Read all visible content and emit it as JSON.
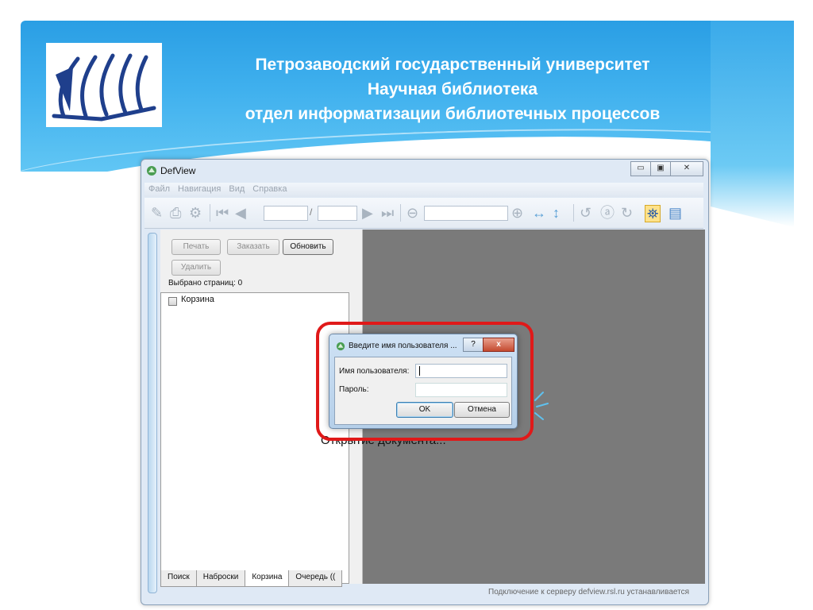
{
  "slide": {
    "title_line1": "Петрозаводский государственный университет",
    "title_line2": "Научная библиотека",
    "title_line3": "отдел информатизации библиотечных процессов"
  },
  "window": {
    "title": "DefView",
    "minimize": "▭",
    "maximize": "▣",
    "close": "✕"
  },
  "menu": [
    "Файл",
    "Навигация",
    "Вид",
    "Справка"
  ],
  "toolbar": {
    "page_separator": "/"
  },
  "panel": {
    "print_label": "Печать",
    "order_label": "Заказать",
    "refresh_label": "Обновить",
    "delete_label": "Удалить",
    "selected_pages": "Выбрано страниц: 0",
    "tree_item": "Корзина",
    "tabs": [
      "Поиск",
      "Наброски",
      "Корзина",
      "Очередь (("
    ],
    "active_tab": "Корзина"
  },
  "viewer": {
    "loading": "Открытие документа..."
  },
  "status": {
    "text": "Подключение к серверу defview.rsl.ru устанавливается"
  },
  "dialog": {
    "title": "Введите имя пользователя ...",
    "help": "?",
    "close": "x",
    "user_label": "Имя пользователя:",
    "password_label": "Пароль:",
    "user_value": "",
    "password_value": "",
    "ok_label": "OK",
    "cancel_label": "Отмена"
  },
  "colors": {
    "banner": "#2a9ee4",
    "highlight": "#e01919",
    "viewer": "#7a7a7a"
  }
}
